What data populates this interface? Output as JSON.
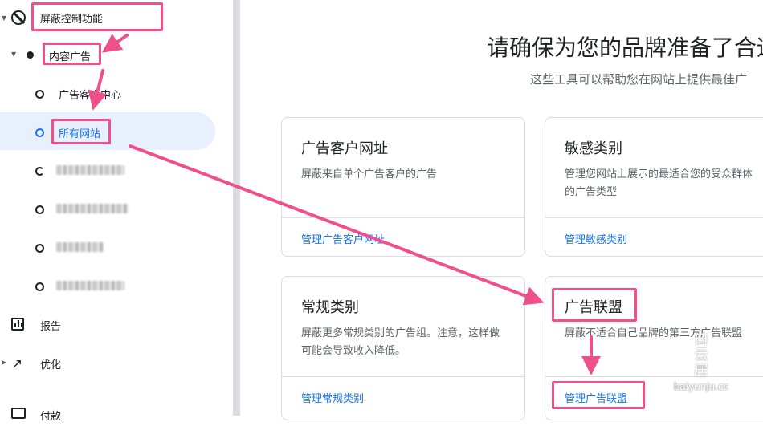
{
  "sidebar": {
    "items": [
      {
        "label": "屏蔽控制功能",
        "icon": "block-icon"
      },
      {
        "label": "内容广告",
        "icon": "bullet-icon"
      },
      {
        "label": "广告客户中心",
        "icon": "ring-icon"
      },
      {
        "label": "所有网站",
        "icon": "ring-icon"
      },
      {
        "label": "",
        "icon": "ring-icon"
      },
      {
        "label": "",
        "icon": "ring-icon"
      },
      {
        "label": "",
        "icon": "ring-icon"
      },
      {
        "label": "",
        "icon": "ring-icon"
      },
      {
        "label": "报告",
        "icon": "bar-chart-icon"
      },
      {
        "label": "优化",
        "icon": "trending-up-icon"
      },
      {
        "label": "付款",
        "icon": "payment-icon"
      }
    ]
  },
  "main": {
    "title": "请确保为您的品牌准备了合适",
    "subtitle": "这些工具可以帮助您在网站上提供最佳广",
    "cards": [
      {
        "title": "广告客户网址",
        "desc": "屏蔽来自单个广告客户的广告",
        "link": "管理广告客户网址"
      },
      {
        "title": "敏感类别",
        "desc": "管理您网站上展示的最适合您的受众群体的广告类型",
        "link": "管理敏感类别"
      },
      {
        "title": "常规类别",
        "desc": "屏蔽更多常规类别的广告组。注意，这样做可能会导致收入降低。",
        "link": "管理常规类别"
      },
      {
        "title": "广告联盟",
        "desc": "屏蔽不适合自己品牌的第三方广告联盟",
        "link": "管理广告联盟"
      }
    ]
  },
  "watermark": {
    "chars": [
      "白",
      "云",
      "居"
    ],
    "url": "baiyunju.cc"
  },
  "colors": {
    "accent": "#1a73e8",
    "highlight": "#f0508a",
    "active_bg": "#e8f0fe"
  }
}
